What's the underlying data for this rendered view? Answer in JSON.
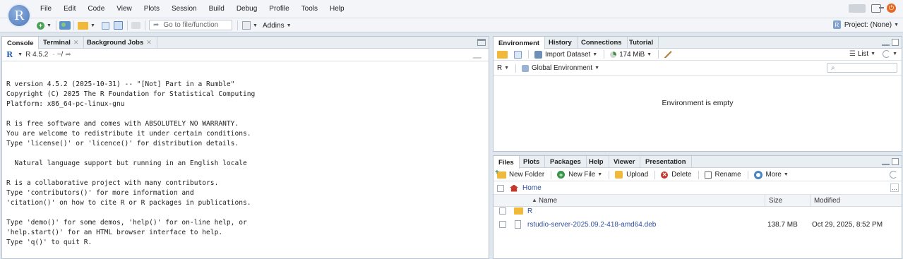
{
  "menubar": {
    "logo_letter": "R",
    "items": [
      "File",
      "Edit",
      "Code",
      "View",
      "Plots",
      "Session",
      "Build",
      "Debug",
      "Profile",
      "Tools",
      "Help"
    ]
  },
  "toolbar": {
    "goto_placeholder": "Go to file/function",
    "addins_label": "Addins",
    "project_label": "Project: (None)"
  },
  "console": {
    "tabs": [
      "Console",
      "Terminal",
      "Background Jobs"
    ],
    "r_version": "R 4.5.2",
    "path": "~/",
    "output": [
      "",
      "R version 4.5.2 (2025-10-31) -- \"[Not] Part in a Rumble\"",
      "Copyright (C) 2025 The R Foundation for Statistical Computing",
      "Platform: x86_64-pc-linux-gnu",
      "",
      "R is free software and comes with ABSOLUTELY NO WARRANTY.",
      "You are welcome to redistribute it under certain conditions.",
      "Type 'license()' or 'licence()' for distribution details.",
      "",
      "  Natural language support but running in an English locale",
      "",
      "R is a collaborative project with many contributors.",
      "Type 'contributors()' for more information and",
      "'citation()' on how to cite R or R packages in publications.",
      "",
      "Type 'demo()' for some demos, 'help()' for on-line help, or",
      "'help.start()' for an HTML browser interface to help.",
      "Type 'q()' to quit R.",
      ""
    ],
    "prompt": ">"
  },
  "environment": {
    "tabs": [
      "Environment",
      "History",
      "Connections",
      "Tutorial"
    ],
    "import_label": "Import Dataset",
    "memory_label": "174 MiB",
    "list_label": "List",
    "lang_label": "R",
    "scope_label": "Global Environment",
    "empty_message": "Environment is empty"
  },
  "files": {
    "tabs": [
      "Files",
      "Plots",
      "Packages",
      "Help",
      "Viewer",
      "Presentation"
    ],
    "actions": {
      "new_folder": "New Folder",
      "new_file": "New File",
      "upload": "Upload",
      "delete": "Delete",
      "rename": "Rename",
      "more": "More"
    },
    "breadcrumb": "Home",
    "columns": {
      "name": "Name",
      "size": "Size",
      "modified": "Modified"
    },
    "rows": [
      {
        "name": "R",
        "size": "",
        "modified": "",
        "type": "folder"
      },
      {
        "name": "rstudio-server-2025.09.2-418-amd64.deb",
        "size": "138.7 MB",
        "modified": "Oct 29, 2025, 8:52 PM",
        "type": "file"
      }
    ]
  }
}
